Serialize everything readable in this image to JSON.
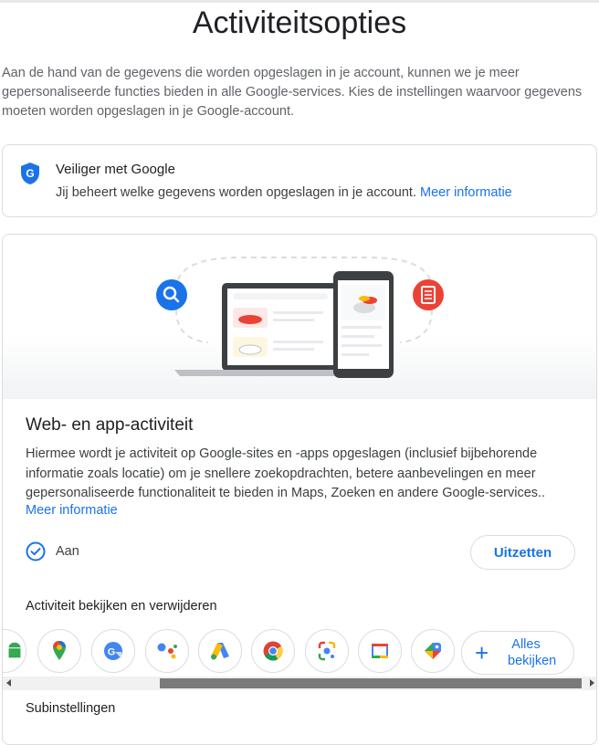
{
  "page": {
    "title": "Activiteitsopties",
    "intro_lines": [
      "Aan de hand van de gegevens die worden opgeslagen in je account, kunnen we je meer",
      "gepersonaliseerde functies bieden in alle Google-services. Kies de instellingen waarvoor gegevens",
      "moeten worden opgeslagen in je Google-account."
    ]
  },
  "safer_card": {
    "title": "Veiliger met Google",
    "text": "Jij beheert welke gegevens worden opgeslagen in je account.",
    "link": "Meer informatie",
    "icon": "shield-g-icon"
  },
  "activity_card": {
    "title": "Web- en app-activiteit",
    "description_lines": [
      "Hiermee wordt je activiteit op Google-sites en -apps opgeslagen (inclusief bijbehorende",
      "informatie zoals locatie) om je snellere zoekopdrachten, betere aanbevelingen en meer",
      "gepersonaliseerde functionaliteit te bieden in Maps, Zoeken en andere Google-services.."
    ],
    "link": "Meer informatie",
    "status": "Aan",
    "turn_off_button": "Uitzetten",
    "view_delete_heading": "Activiteit bekijken en verwijderen",
    "apps": [
      "android-icon",
      "maps-icon",
      "translate-icon",
      "assistant-icon",
      "ads-icon",
      "chrome-icon",
      "lens-icon",
      "calendar-icon",
      "shopping-icon"
    ],
    "see_all_line1": "Alles",
    "see_all_line2": "bekijken",
    "subsettings_heading": "Subinstellingen"
  },
  "colors": {
    "accent": "#1a73e8",
    "text": "#202124",
    "muted": "#5f6368",
    "border": "#dadce0"
  }
}
